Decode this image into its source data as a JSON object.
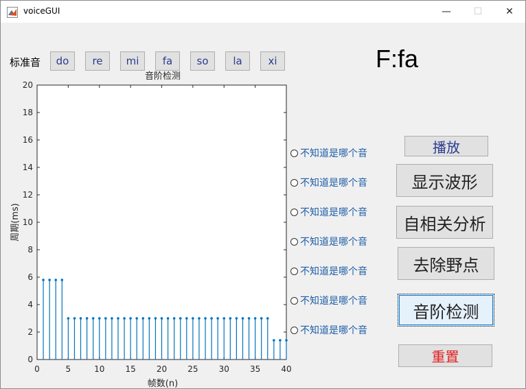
{
  "window": {
    "title": "voiceGUI",
    "minimize_glyph": "—",
    "maximize_glyph": "☐",
    "close_glyph": "✕"
  },
  "standard_tones": {
    "label": "标准音",
    "buttons": [
      "do",
      "re",
      "mi",
      "fa",
      "so",
      "la",
      "xi"
    ]
  },
  "note_display": "F:fa",
  "radios": [
    "不知道是哪个音",
    "不知道是哪个音",
    "不知道是哪个音",
    "不知道是哪个音",
    "不知道是哪个音",
    "不知道是哪个音",
    "不知道是哪个音"
  ],
  "controls": {
    "play": "播放",
    "show_waveform": "显示波形",
    "autocorrelation": "自相关分析",
    "remove_outliers": "去除野点",
    "pitch_detection": "音阶检测",
    "reset": "重置"
  },
  "colors": {
    "stem": "#0072bd",
    "blue_text": "#2a3b8f",
    "radio_text": "#1f5ea8",
    "reset_text": "#e02020"
  },
  "chart_data": {
    "type": "stem",
    "title": "音阶检测",
    "xlabel": "帧数(n)",
    "ylabel": "周期(ms)",
    "xlim": [
      0,
      40
    ],
    "ylim": [
      0,
      20
    ],
    "xticks": [
      0,
      5,
      10,
      15,
      20,
      25,
      30,
      35,
      40
    ],
    "yticks": [
      0,
      2,
      4,
      6,
      8,
      10,
      12,
      14,
      16,
      18,
      20
    ],
    "x": [
      1,
      2,
      3,
      4,
      5,
      6,
      7,
      8,
      9,
      10,
      11,
      12,
      13,
      14,
      15,
      16,
      17,
      18,
      19,
      20,
      21,
      22,
      23,
      24,
      25,
      26,
      27,
      28,
      29,
      30,
      31,
      32,
      33,
      34,
      35,
      36,
      37,
      38,
      39,
      40
    ],
    "y": [
      5.8,
      5.8,
      5.8,
      5.8,
      3.0,
      3.0,
      3.0,
      3.0,
      3.0,
      3.0,
      3.0,
      3.0,
      3.0,
      3.0,
      3.0,
      3.0,
      3.0,
      3.0,
      3.0,
      3.0,
      3.0,
      3.0,
      3.0,
      3.0,
      3.0,
      3.0,
      3.0,
      3.0,
      3.0,
      3.0,
      3.0,
      3.0,
      3.0,
      3.0,
      3.0,
      3.0,
      3.0,
      1.4,
      1.4,
      1.4
    ],
    "grid": false
  }
}
